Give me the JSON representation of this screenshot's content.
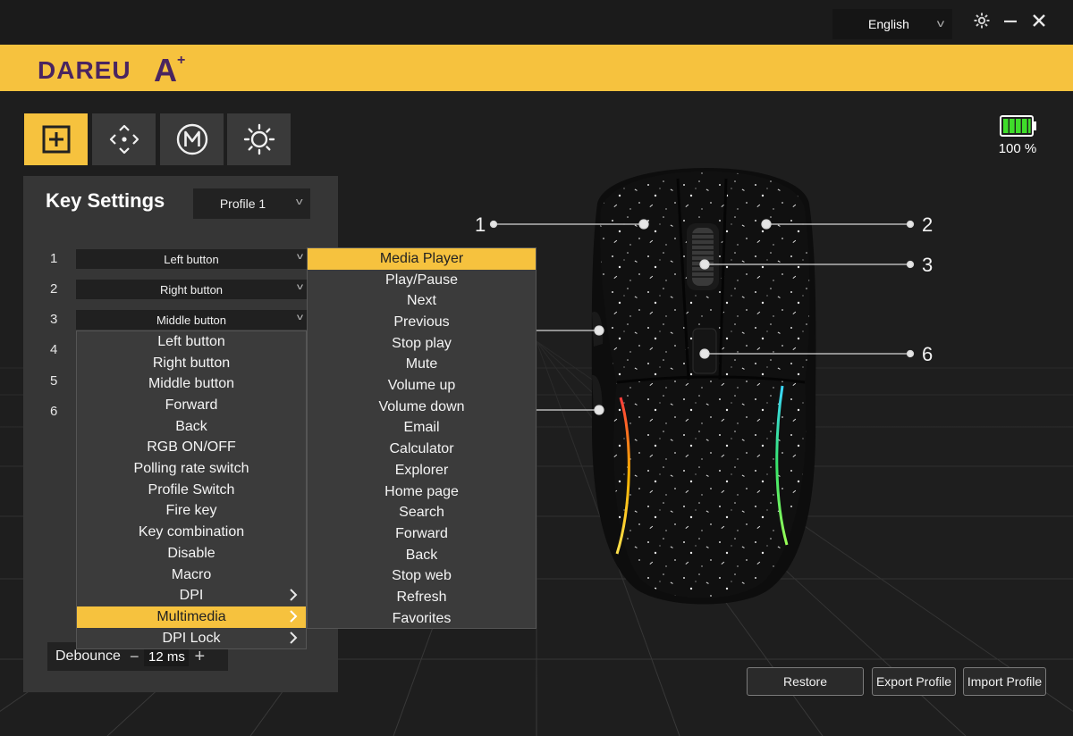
{
  "titlebar": {
    "language": "English",
    "settings_icon": "gear-icon",
    "minimize_icon": "minimize-icon",
    "close_icon": "close-icon"
  },
  "brand": {
    "logo_text": "DAREU",
    "logo_mark": "A",
    "logo_plus": "+"
  },
  "colors": {
    "accent": "#f6c23e",
    "brand_purple": "#4a2560",
    "panel": "#363636",
    "background": "#1e1e1e",
    "battery": "#3fdc2a"
  },
  "mode_tabs": [
    {
      "icon": "plus-box-icon",
      "active": true
    },
    {
      "icon": "dpi-arrows-icon",
      "active": false
    },
    {
      "icon": "macro-m-icon",
      "active": false
    },
    {
      "icon": "lighting-sun-icon",
      "active": false
    }
  ],
  "battery": {
    "percent_label": "100 %",
    "level": 1.0
  },
  "key_settings": {
    "title": "Key Settings",
    "profile": "Profile 1",
    "rows": [
      {
        "num": "1",
        "value": "Left button"
      },
      {
        "num": "2",
        "value": "Right button"
      },
      {
        "num": "3",
        "value": "Middle button"
      },
      {
        "num": "4",
        "value": ""
      },
      {
        "num": "5",
        "value": ""
      },
      {
        "num": "6",
        "value": ""
      }
    ]
  },
  "key_menu": {
    "items": [
      {
        "label": "Left button"
      },
      {
        "label": "Right button"
      },
      {
        "label": "Middle button"
      },
      {
        "label": "Forward"
      },
      {
        "label": "Back"
      },
      {
        "label": "RGB ON/OFF"
      },
      {
        "label": "Polling rate switch"
      },
      {
        "label": "Profile Switch"
      },
      {
        "label": "Fire key"
      },
      {
        "label": "Key combination"
      },
      {
        "label": "Disable"
      },
      {
        "label": "Macro"
      },
      {
        "label": "DPI",
        "submenu": true
      },
      {
        "label": "Multimedia",
        "submenu": true,
        "selected": true
      },
      {
        "label": "DPI Lock",
        "submenu": true
      }
    ]
  },
  "media_menu": {
    "items": [
      {
        "label": "Media Player",
        "selected": true
      },
      {
        "label": "Play/Pause"
      },
      {
        "label": "Next"
      },
      {
        "label": "Previous"
      },
      {
        "label": "Stop play"
      },
      {
        "label": "Mute"
      },
      {
        "label": "Volume up"
      },
      {
        "label": "Volume down"
      },
      {
        "label": "Email"
      },
      {
        "label": "Calculator"
      },
      {
        "label": "Explorer"
      },
      {
        "label": "Home page"
      },
      {
        "label": "Search"
      },
      {
        "label": "Forward"
      },
      {
        "label": "Back"
      },
      {
        "label": "Stop web"
      },
      {
        "label": "Refresh"
      },
      {
        "label": "Favorites"
      }
    ]
  },
  "debounce": {
    "label": "Debounce",
    "value": "12 ms",
    "minus": "−",
    "plus": "+"
  },
  "callouts": [
    "1",
    "2",
    "3",
    "6"
  ],
  "buttons": {
    "restore": "Restore",
    "export": "Export Profile",
    "import": "Import Profile"
  }
}
